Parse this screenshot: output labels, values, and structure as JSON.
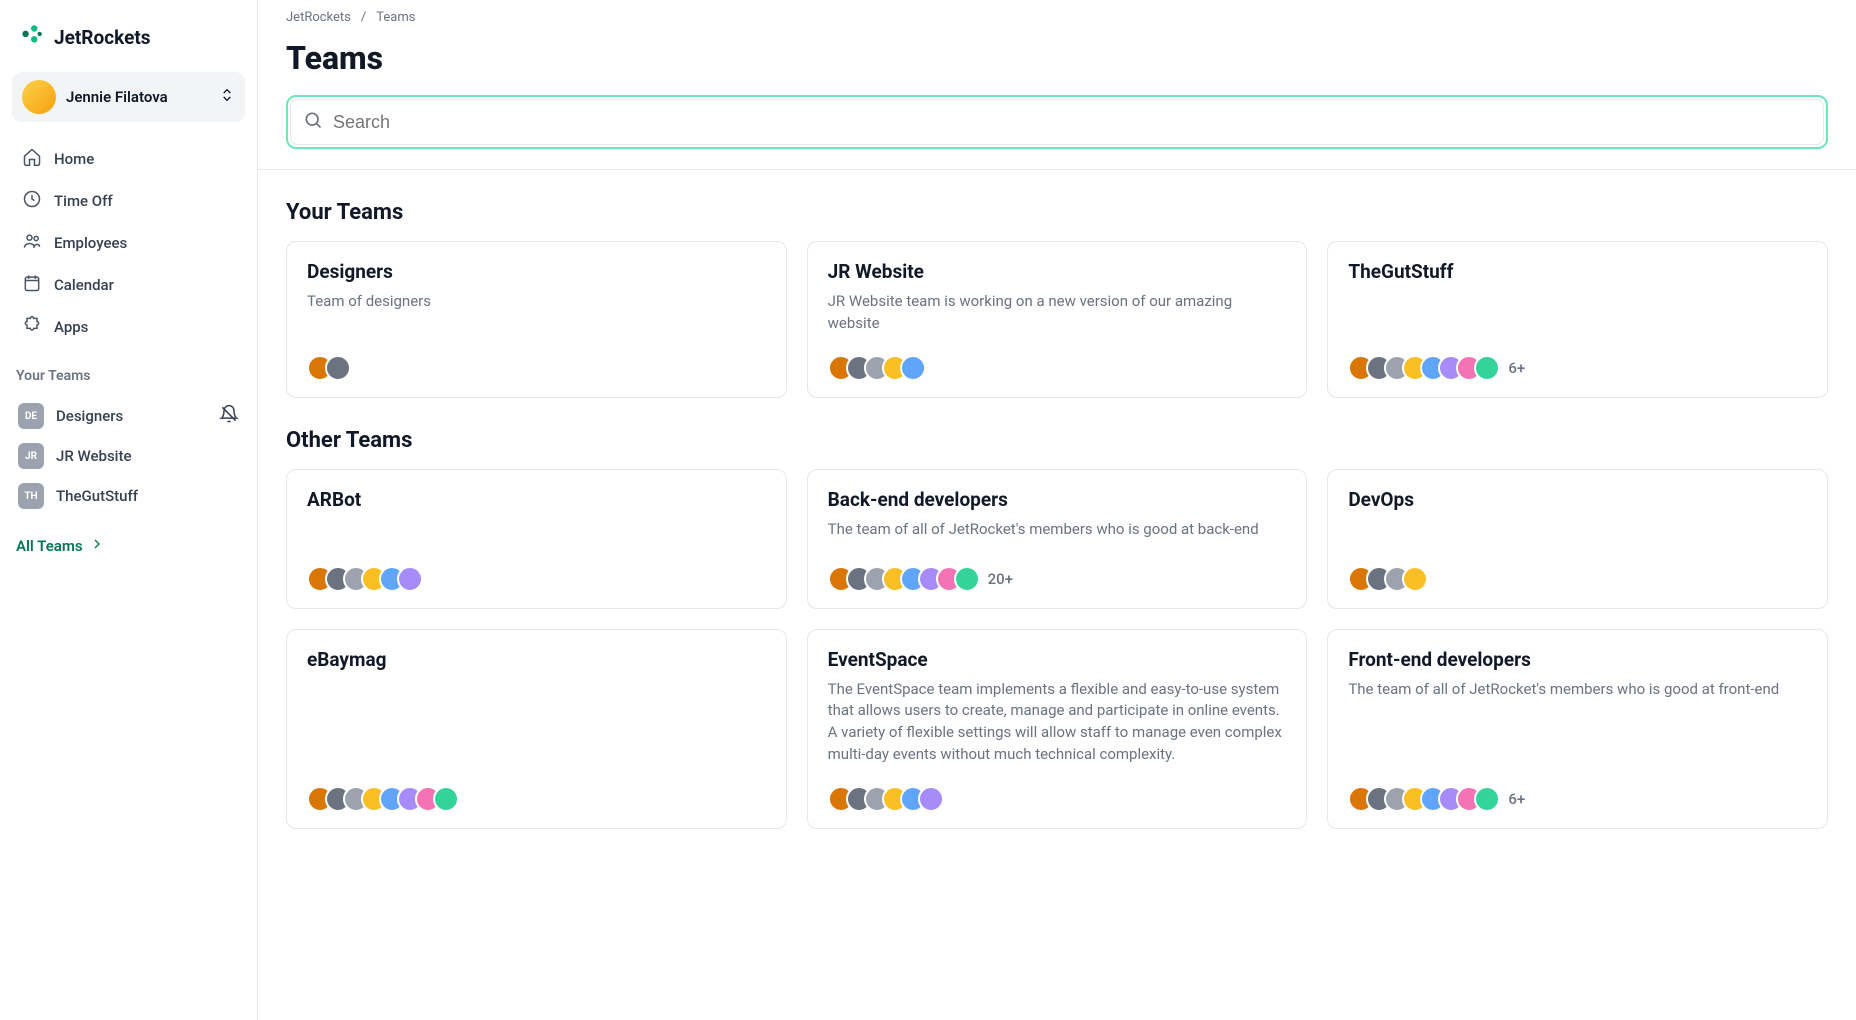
{
  "brand": {
    "name": "JetRockets"
  },
  "user": {
    "name": "Jennie Filatova"
  },
  "nav": [
    {
      "label": "Home",
      "icon": "home-icon"
    },
    {
      "label": "Time Off",
      "icon": "clock-icon"
    },
    {
      "label": "Employees",
      "icon": "people-icon"
    },
    {
      "label": "Calendar",
      "icon": "calendar-icon"
    },
    {
      "label": "Apps",
      "icon": "puzzle-icon"
    }
  ],
  "sidebar": {
    "section_label": "Your Teams",
    "teams": [
      {
        "abbr": "DE",
        "label": "Designers",
        "muted": true
      },
      {
        "abbr": "JR",
        "label": "JR Website",
        "muted": false
      },
      {
        "abbr": "TH",
        "label": "TheGutStuff",
        "muted": false
      }
    ],
    "all_teams_label": "All Teams"
  },
  "breadcrumbs": [
    "JetRockets",
    "Teams"
  ],
  "page_title": "Teams",
  "search": {
    "placeholder": "Search"
  },
  "sections": {
    "your_teams": {
      "heading": "Your Teams",
      "cards": [
        {
          "title": "Designers",
          "desc": "Team of designers",
          "muted": true,
          "avatars": 2,
          "more": ""
        },
        {
          "title": "JR Website",
          "desc": "JR Website team is working on a new version of our amazing website",
          "muted": false,
          "avatars": 5,
          "more": ""
        },
        {
          "title": "TheGutStuff",
          "desc": "",
          "muted": false,
          "avatars": 8,
          "more": "6+"
        }
      ]
    },
    "other_teams": {
      "heading": "Other Teams",
      "cards": [
        {
          "title": "ARBot",
          "desc": "",
          "avatars": 6,
          "more": ""
        },
        {
          "title": "Back-end developers",
          "desc": "The team of all of JetRocket's members who is good at back-end",
          "avatars": 8,
          "more": "20+"
        },
        {
          "title": "DevOps",
          "desc": "",
          "avatars": 4,
          "more": ""
        },
        {
          "title": "eBaymag",
          "desc": "",
          "avatars": 8,
          "more": ""
        },
        {
          "title": "EventSpace",
          "desc": "The EventSpace team implements a flexible and easy-to-use system that allows users to create, manage and participate in online events. A variety of flexible settings will allow staff to manage even complex multi-day events without much technical complexity.",
          "avatars": 6,
          "more": ""
        },
        {
          "title": "Front-end developers",
          "desc": "The team of all of JetRocket's members who is good at front-end",
          "avatars": 8,
          "more": "6+"
        }
      ]
    }
  }
}
